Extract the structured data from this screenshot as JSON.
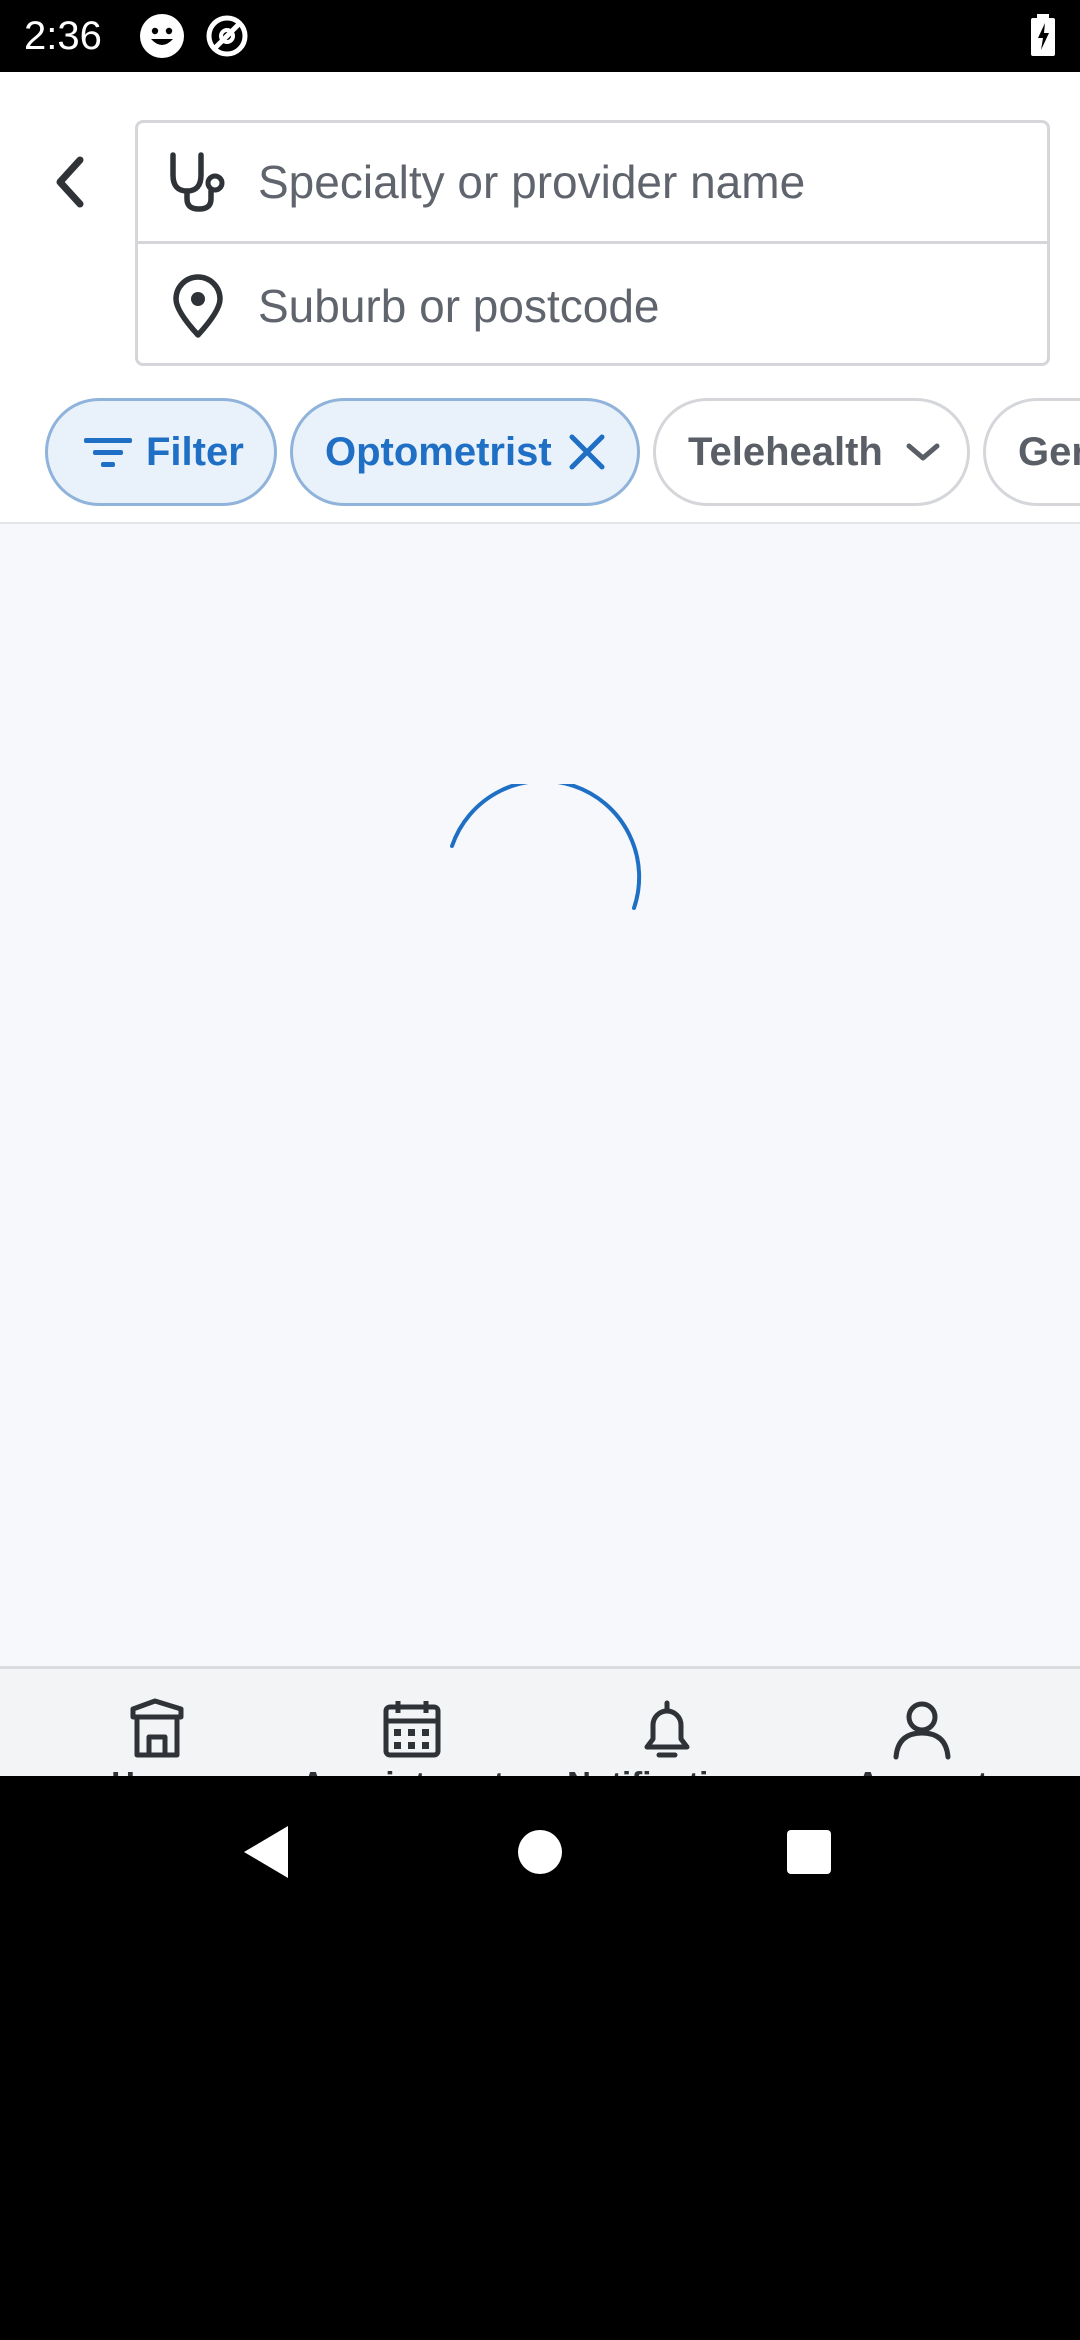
{
  "status_bar": {
    "time": "2:36"
  },
  "search": {
    "specialty_placeholder": "Specialty or provider name",
    "location_placeholder": "Suburb or postcode"
  },
  "chips": {
    "filter_label": "Filter",
    "optometrist_label": "Optometrist",
    "telehealth_label": "Telehealth",
    "partial_label": "Ger"
  },
  "bottom_nav": {
    "items": [
      {
        "label": "Home",
        "icon": "home-icon"
      },
      {
        "label": "Appointments",
        "icon": "calendar-icon"
      },
      {
        "label": "Notifications",
        "icon": "bell-icon"
      },
      {
        "label": "Account",
        "icon": "person-icon"
      }
    ]
  },
  "colors": {
    "accent": "#1f6fc5",
    "chip_selected_bg": "#e9f1fa",
    "content_bg": "#f6f8fb",
    "nav_bg": "#f3f4f5"
  }
}
